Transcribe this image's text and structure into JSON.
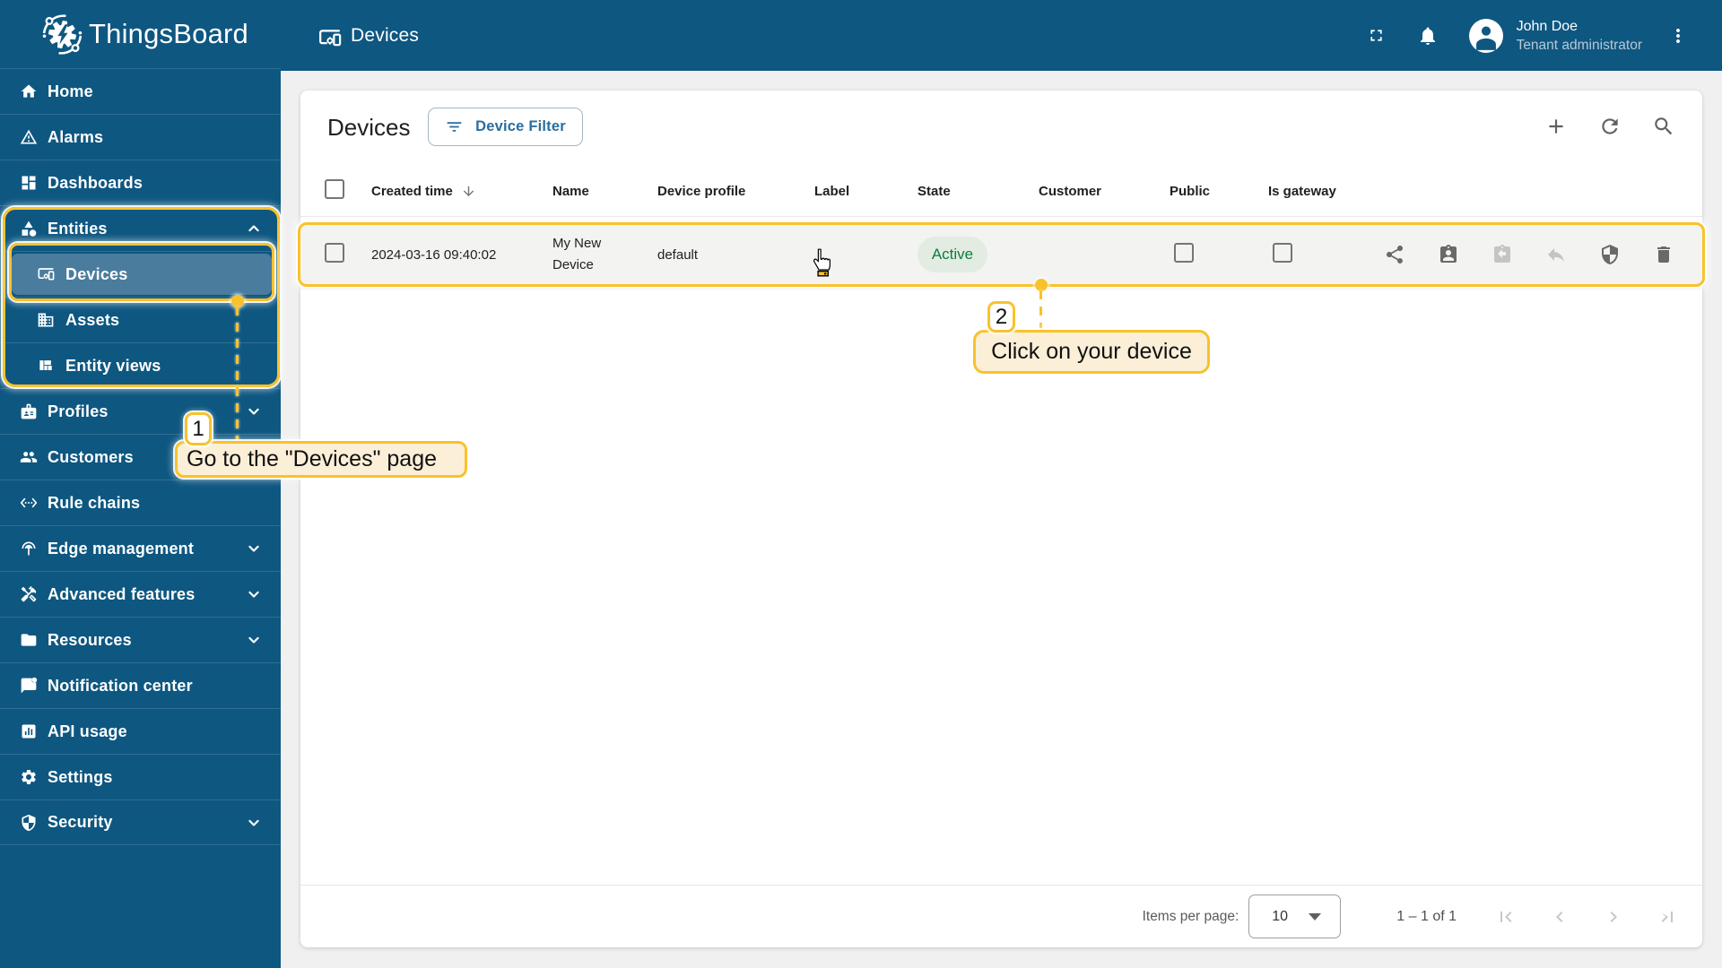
{
  "app": {
    "brand": "ThingsBoard",
    "colors": {
      "primary_blue": "#0E5781",
      "selected_item_blue": "#4A7C9E",
      "annotation_yellow": "#F9C22B",
      "annotation_tooltip_bg": "#FBEFD8",
      "active_green": "#0E7D3B",
      "active_pill_bg": "#E2ECE3"
    }
  },
  "sidebar": {
    "logo_text": "ThingsBoard",
    "items": [
      {
        "label": "Home",
        "icon": "home-icon",
        "indent": false,
        "chevron": "",
        "selected": false
      },
      {
        "label": "Alarms",
        "icon": "alarms-warning-icon",
        "indent": false,
        "chevron": "",
        "selected": false
      },
      {
        "label": "Dashboards",
        "icon": "dashboards-icon",
        "indent": false,
        "chevron": "",
        "selected": false
      },
      {
        "label": "Entities",
        "icon": "entities-category-icon",
        "indent": false,
        "chevron": "up",
        "selected": false
      },
      {
        "label": "Devices",
        "icon": "devices-icon",
        "indent": true,
        "chevron": "",
        "selected": true
      },
      {
        "label": "Assets",
        "icon": "assets-building-icon",
        "indent": true,
        "chevron": "",
        "selected": false
      },
      {
        "label": "Entity views",
        "icon": "entity-views-icon",
        "indent": true,
        "chevron": "",
        "selected": false
      },
      {
        "label": "Profiles",
        "icon": "profiles-badge-icon",
        "indent": false,
        "chevron": "down",
        "selected": false
      },
      {
        "label": "Customers",
        "icon": "customers-people-icon",
        "indent": false,
        "chevron": "",
        "selected": false
      },
      {
        "label": "Rule chains",
        "icon": "rule-chains-icon",
        "indent": false,
        "chevron": "",
        "selected": false
      },
      {
        "label": "Edge management",
        "icon": "edge-antenna-icon",
        "indent": false,
        "chevron": "down",
        "selected": false
      },
      {
        "label": "Advanced features",
        "icon": "advanced-tools-icon",
        "indent": false,
        "chevron": "down",
        "selected": false
      },
      {
        "label": "Resources",
        "icon": "resources-folder-icon",
        "indent": false,
        "chevron": "down",
        "selected": false
      },
      {
        "label": "Notification center",
        "icon": "notification-center-icon",
        "indent": false,
        "chevron": "",
        "selected": false
      },
      {
        "label": "API usage",
        "icon": "api-usage-chart-icon",
        "indent": false,
        "chevron": "",
        "selected": false
      },
      {
        "label": "Settings",
        "icon": "settings-gear-icon",
        "indent": false,
        "chevron": "",
        "selected": false
      },
      {
        "label": "Security",
        "icon": "security-shield-icon",
        "indent": false,
        "chevron": "down",
        "selected": false
      }
    ]
  },
  "topbar": {
    "title": "Devices",
    "user": {
      "name": "John Doe",
      "role": "Tenant administrator"
    }
  },
  "card": {
    "title": "Devices",
    "filter_button_label": "Device Filter"
  },
  "table": {
    "columns": [
      "Created time",
      "Name",
      "Device profile",
      "Label",
      "State",
      "Customer",
      "Public",
      "Is gateway"
    ],
    "sorted_column": "Created time",
    "row": {
      "created_time": "2024-03-16 09:40:02",
      "name": "My New Device",
      "device_profile": "default",
      "label": "",
      "state": "Active",
      "customer": "",
      "public_checked": false,
      "is_gateway_checked": false
    },
    "row_actions": [
      {
        "name": "share",
        "icon": "share-icon",
        "enabled": true
      },
      {
        "name": "assign-to-customer",
        "icon": "assign-customer-icon",
        "enabled": true
      },
      {
        "name": "unassign-from-customer",
        "icon": "unassign-customer-icon",
        "enabled": false
      },
      {
        "name": "make-private",
        "icon": "make-private-reply-icon",
        "enabled": false
      },
      {
        "name": "manage-credentials",
        "icon": "credentials-shield-icon",
        "enabled": true
      },
      {
        "name": "delete",
        "icon": "delete-trash-icon",
        "enabled": true
      }
    ]
  },
  "pagination": {
    "items_per_page_label": "Items per page:",
    "page_size": "10",
    "range_label": "1 – 1 of 1"
  },
  "annotations": {
    "step1": {
      "number": "1",
      "text": "Go to the \"Devices\" page"
    },
    "step2": {
      "number": "2",
      "text": "Click on your device"
    }
  }
}
